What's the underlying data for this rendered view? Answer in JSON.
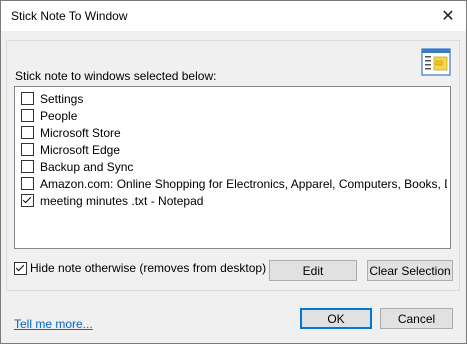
{
  "window": {
    "title": "Stick Note To Window",
    "close_glyph": "✕"
  },
  "list": {
    "label": "Stick note to windows selected below:",
    "items": [
      {
        "label": "Settings",
        "checked": false
      },
      {
        "label": "People",
        "checked": false
      },
      {
        "label": "Microsoft Store",
        "checked": false
      },
      {
        "label": "Microsoft Edge",
        "checked": false
      },
      {
        "label": "Backup and Sync",
        "checked": false
      },
      {
        "label": "Amazon.com: Online Shopping for Electronics, Apparel, Computers, Books, DVDs &...",
        "checked": false
      },
      {
        "label": "meeting minutes .txt - Notepad",
        "checked": true
      }
    ]
  },
  "hide_option": {
    "label": "Hide note otherwise (removes from desktop)",
    "checked": true
  },
  "buttons": {
    "edit": "Edit",
    "clear_selection": "Clear Selection",
    "ok": "OK",
    "cancel": "Cancel"
  },
  "link": {
    "tell_me_more": "Tell me more..."
  },
  "icons": {
    "app": "sticky-note-window-icon",
    "close": "close-icon"
  },
  "colors": {
    "accent": "#0078d7",
    "link": "#0066cc"
  }
}
